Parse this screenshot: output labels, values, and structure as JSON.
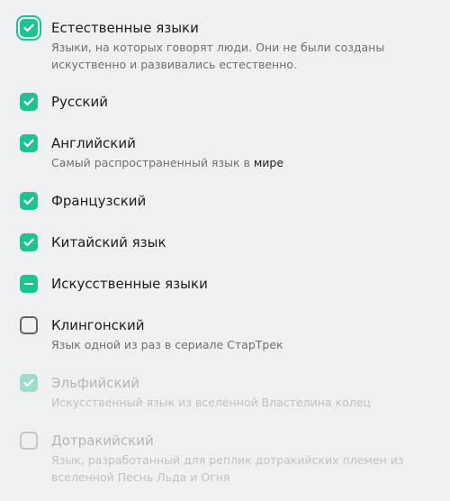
{
  "items": [
    {
      "label": "Естественные языки",
      "desc": "Языки, на которых говорят люди. Они не были созданы искуственно и развивались естественно.",
      "state": "checked"
    },
    {
      "label": "Русский",
      "state": "checked"
    },
    {
      "label": "Английский",
      "desc_start": "Самый распространенный язык в ",
      "desc_end": "мире",
      "state": "checked"
    },
    {
      "label": "Французский",
      "state": "checked"
    },
    {
      "label": "Китайский язык",
      "state": "checked"
    },
    {
      "label": "Искусственные языки",
      "state": "indeterminate"
    },
    {
      "label": "Клингонский",
      "desc": "Язык одной из раз в сериале СтарТрек",
      "state": "unchecked"
    },
    {
      "label": "Эльфийский",
      "desc": "Искусственный язык из вселенной Властелина колец",
      "state": "checked-disabled"
    },
    {
      "label": "Дотракийский",
      "desc": "Язык, разработанный для реплик дотракийских племен из вселенной Песнь Льда и Огня",
      "state": "unchecked-disabled"
    }
  ],
  "colors": {
    "accent": "#1fc292",
    "accent_disabled": "#9fdcc8",
    "background": "#eff0f2"
  }
}
